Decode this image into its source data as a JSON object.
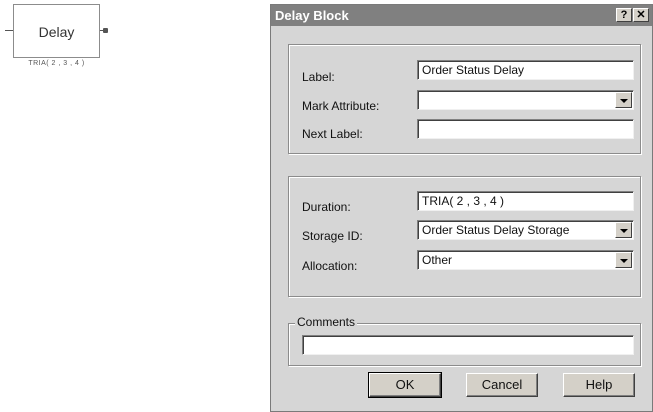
{
  "block": {
    "label": "Delay",
    "subtitle": "TRIA( 2 , 3 , 4 )"
  },
  "dialog": {
    "title": "Delay Block",
    "help_glyph": "?",
    "close_glyph": "✕",
    "fields": {
      "label": {
        "caption": "Label:",
        "value": "Order Status Delay"
      },
      "mark_attribute": {
        "caption": "Mark Attribute:",
        "value": ""
      },
      "next_label": {
        "caption": "Next Label:",
        "value": ""
      },
      "duration": {
        "caption": "Duration:",
        "value": "TRIA( 2 , 3 , 4 )"
      },
      "storage_id": {
        "caption": "Storage ID:",
        "value": "Order Status Delay Storage"
      },
      "allocation": {
        "caption": "Allocation:",
        "value": "Other"
      }
    },
    "comments": {
      "caption": "Comments",
      "value": ""
    },
    "buttons": {
      "ok": "OK",
      "cancel": "Cancel",
      "help": "Help"
    }
  }
}
